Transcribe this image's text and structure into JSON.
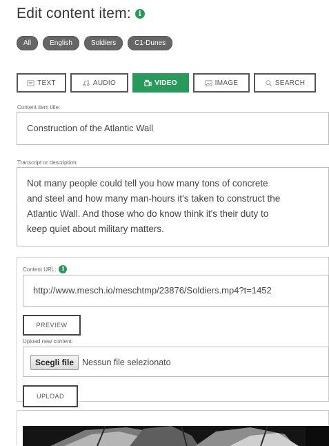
{
  "header": {
    "title": "Edit content item:",
    "info_icon": "info-icon"
  },
  "tags": [
    "All",
    "English",
    "Soldiers",
    "C1-Dunes"
  ],
  "tabs": [
    {
      "label": "TEXT",
      "icon": "text-doc-icon",
      "active": false
    },
    {
      "label": "AUDIO",
      "icon": "audio-icon",
      "active": false
    },
    {
      "label": "VIDEO",
      "icon": "video-camera-icon",
      "active": true
    },
    {
      "label": "IMAGE",
      "icon": "image-icon",
      "active": false
    },
    {
      "label": "SEARCH",
      "icon": "search-icon",
      "active": false
    }
  ],
  "content_title": {
    "label": "Content item title:",
    "value": "Construction of the Atlantic Wall"
  },
  "transcript": {
    "label": "Transcript or description:",
    "lines": [
      "Not many people could tell you how many tons of concrete",
      "and steel and how many man-hours it's taken to construct the",
      "Atlantic Wall. And those who do know think it's their duty to",
      "keep quiet about military matters."
    ]
  },
  "content_url": {
    "label": "Content URL:",
    "value": "http://www.mesch.io/meschtmp/23876/Soldiers.mp4?t=1452"
  },
  "preview_button": "PREVIEW",
  "upload": {
    "label": "Upload new content:",
    "choose_button": "Scegli file",
    "no_file_text": "Nessun file selezionato",
    "upload_button": "UPLOAD"
  },
  "colors": {
    "accent": "#2a9a5c",
    "tag_bg": "#666666",
    "border": "#444444"
  }
}
